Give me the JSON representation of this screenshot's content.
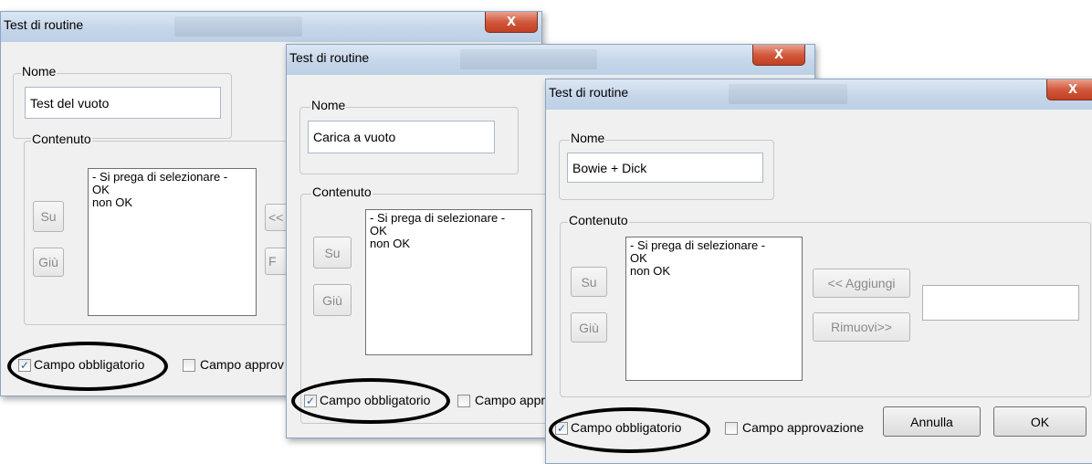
{
  "dialogs": [
    {
      "title": "Test di routine",
      "close_label": "X",
      "name_group_label": "Nome",
      "name_value": "Test del vuoto",
      "content_group_label": "Contenuto",
      "list_items": [
        "- Si prega di selezionare -",
        "OK",
        "non OK"
      ],
      "up_label": "Su",
      "down_label": "Giù",
      "add_label_partial": "<<",
      "remove_label_partial": "F",
      "mandatory_label": "Campo obbligatorio",
      "mandatory_checked": true,
      "approval_label": "Campo approv"
    },
    {
      "title": "Test di routine",
      "close_label": "X",
      "name_group_label": "Nome",
      "name_value": "Carica a vuoto",
      "content_group_label": "Contenuto",
      "list_items": [
        "- Si prega di selezionare -",
        "OK",
        "non OK"
      ],
      "up_label": "Su",
      "down_label": "Giù",
      "mandatory_label": "Campo obbligatorio",
      "mandatory_checked": true,
      "approval_label": "Campo appr"
    },
    {
      "title": "Test di routine",
      "close_label": "X",
      "name_group_label": "Nome",
      "name_value": "Bowie + Dick",
      "content_group_label": "Contenuto",
      "list_items": [
        "- Si prega di selezionare -",
        "OK",
        "non OK"
      ],
      "up_label": "Su",
      "down_label": "Giù",
      "add_label": "<< Aggiungi",
      "remove_label": "Rimuovi>>",
      "new_item_value": "",
      "mandatory_label": "Campo obbligatorio",
      "mandatory_checked": true,
      "approval_label": "Campo approvazione",
      "cancel_label": "Annulla",
      "ok_label": "OK"
    }
  ],
  "check_glyph": "✓"
}
